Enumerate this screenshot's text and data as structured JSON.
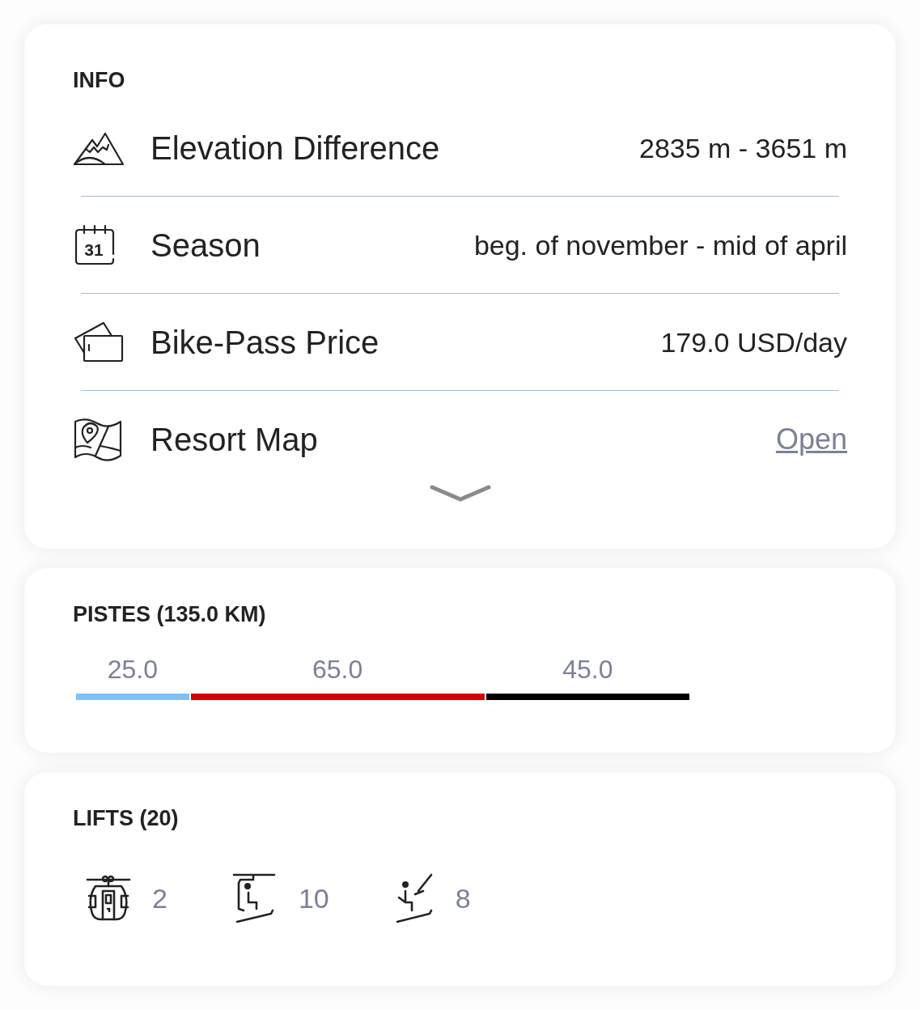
{
  "info": {
    "title": "INFO",
    "expanded": false,
    "rows": [
      {
        "label": "Elevation Difference",
        "value": "2835 m - 3651 m",
        "kind": "text"
      },
      {
        "icon_text": "31",
        "label": "Season",
        "value": "beg. of november - mid of april",
        "kind": "text"
      },
      {
        "label": "Bike-Pass Price",
        "value": "179.0 USD/day",
        "kind": "text"
      },
      {
        "label": "Resort Map",
        "value": "Open",
        "kind": "link"
      }
    ]
  },
  "pistes": {
    "title": "PISTES (135.0 KM)",
    "segments": [
      {
        "label": "25.0",
        "color": "#7cc2f5"
      },
      {
        "label": "65.0",
        "color": "#d90000"
      },
      {
        "label": "45.0",
        "color": "#000000"
      }
    ]
  },
  "lifts": {
    "title": "LIFTS (20)",
    "items": [
      {
        "kind": "gondola",
        "count": "2"
      },
      {
        "kind": "chairlift",
        "count": "10"
      },
      {
        "kind": "draglift",
        "count": "8"
      }
    ]
  }
}
